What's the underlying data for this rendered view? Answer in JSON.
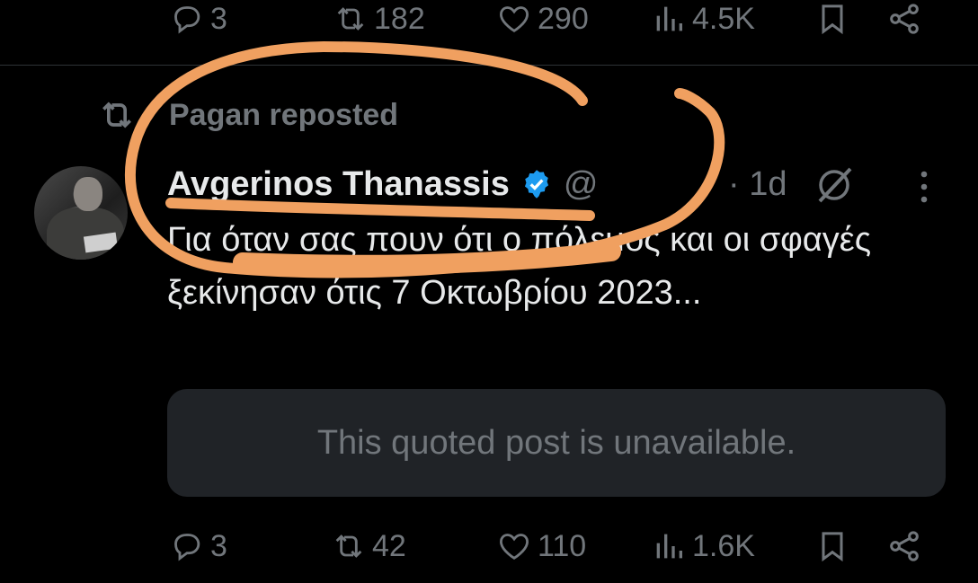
{
  "top_actions": {
    "replies": "3",
    "reposts": "182",
    "likes": "290",
    "views": "4.5K"
  },
  "post": {
    "repost_label": "Pagan reposted",
    "author_name": "Avgerinos Thanassis",
    "handle": "@",
    "time": "· 1d",
    "text": "Για όταν σας πουν ότι ο πόλεμος και οι σφαγές ξεκίνησαν ότις 7 Οκτωβρίου 2023...",
    "quote_unavailable": "This quoted post is unavailable.",
    "actions": {
      "replies": "3",
      "reposts": "42",
      "likes": "110",
      "views": "1.6K"
    }
  },
  "icons": {
    "reply": "reply-icon",
    "repost": "repost-icon",
    "like": "heart-icon",
    "views": "analytics-icon",
    "bookmark": "bookmark-icon",
    "share": "share-icon",
    "verified": "verified-badge-icon",
    "grok": "grok-icon",
    "more": "more-icon"
  },
  "colors": {
    "background": "#000000",
    "text": "#e7e9ea",
    "muted": "#71767b",
    "verified": "#1d9bf0",
    "quote_bg": "#202327",
    "annotation": "#f0a060"
  }
}
